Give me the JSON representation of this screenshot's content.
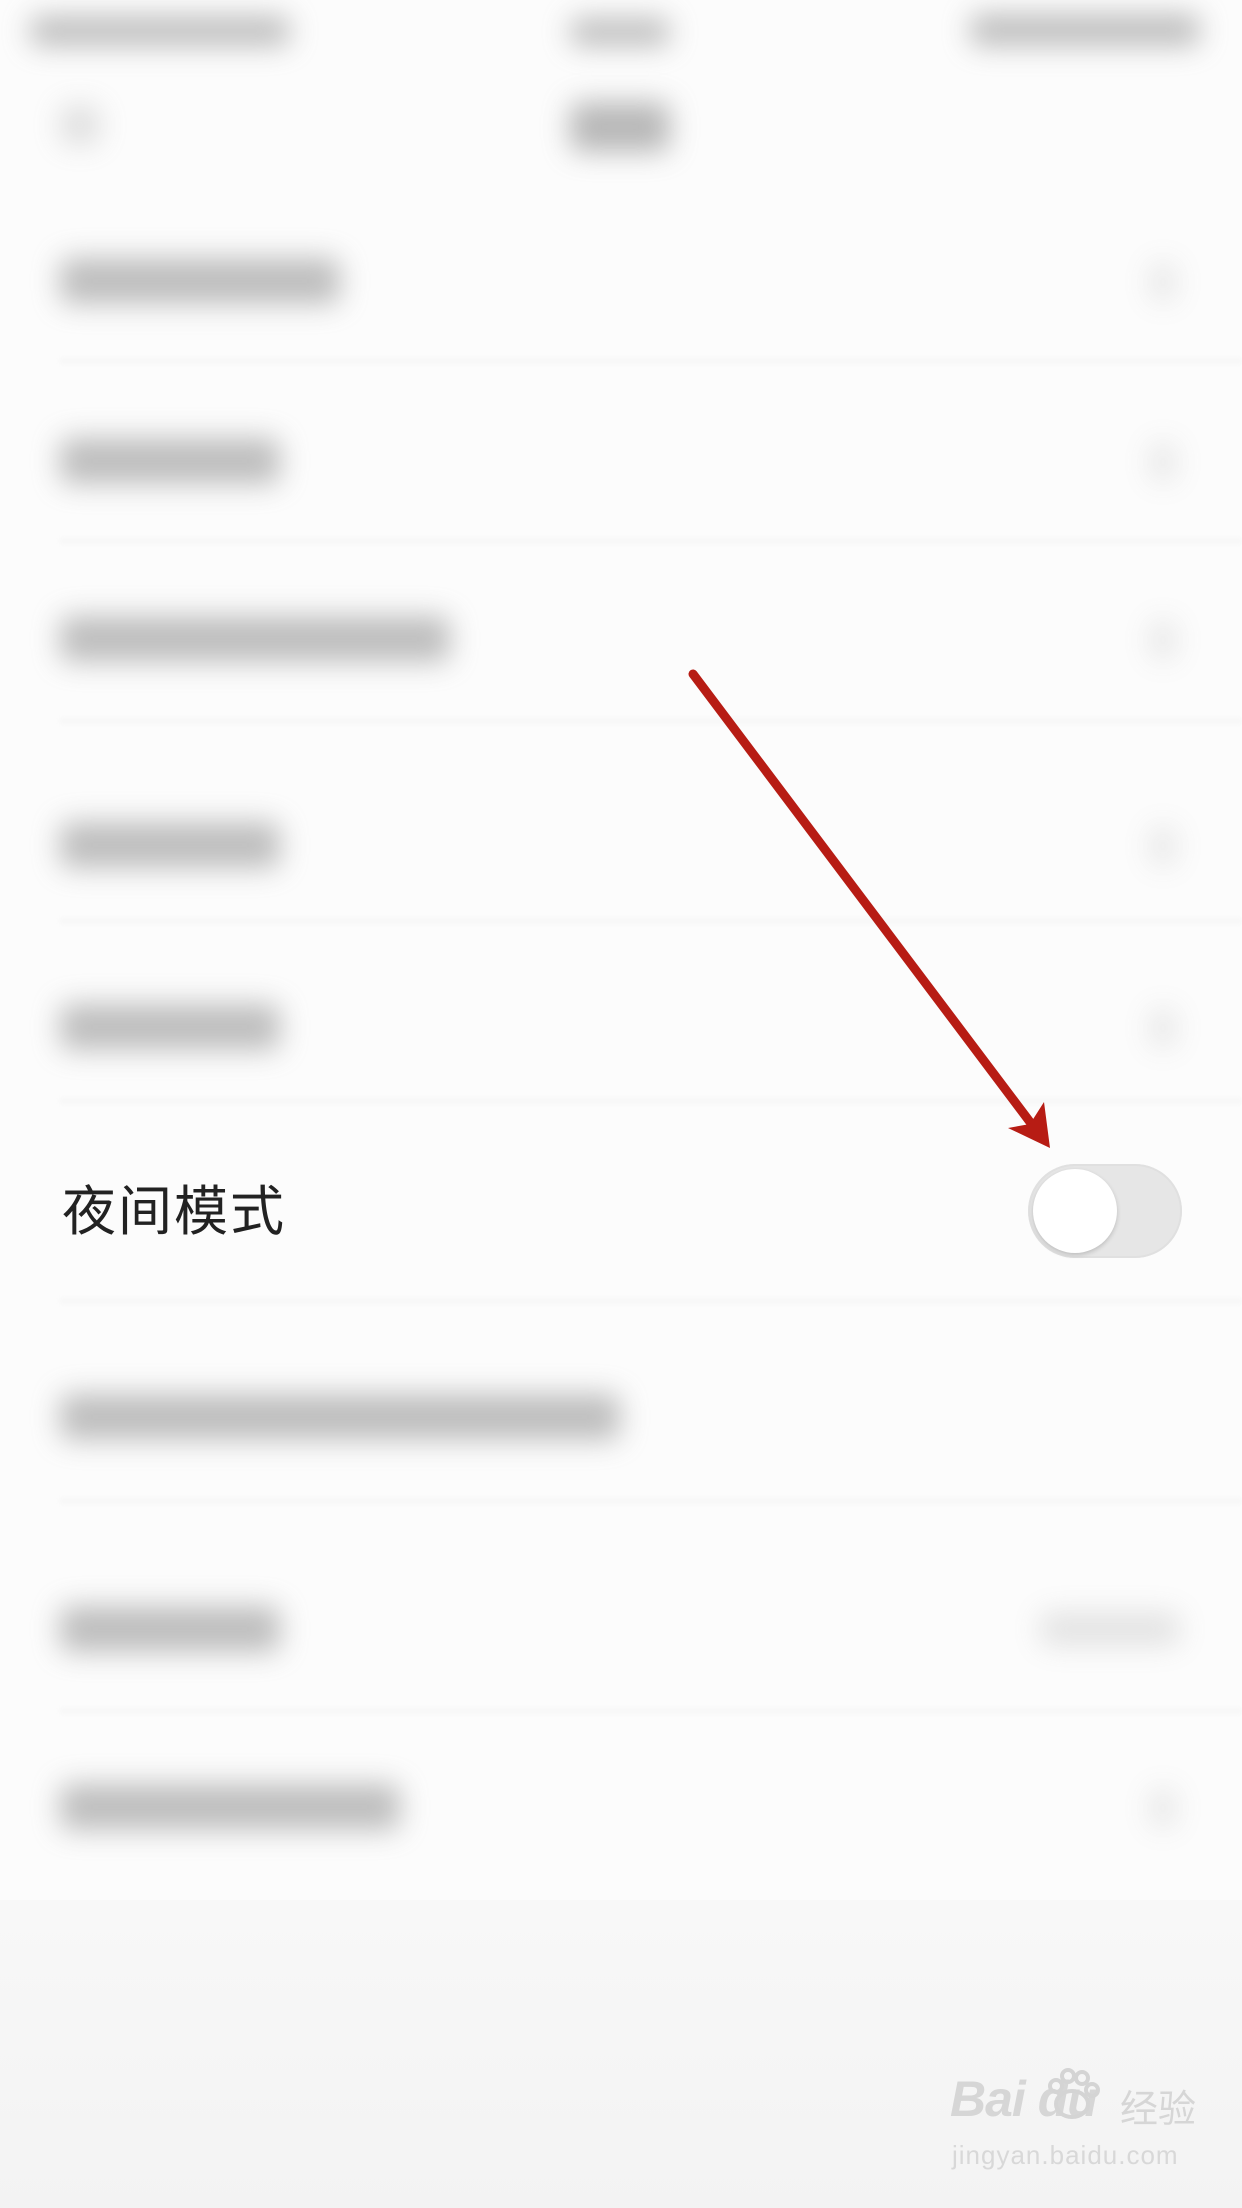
{
  "settings": {
    "night_mode_label": "夜间模式",
    "night_mode_on": false
  },
  "annotation": {
    "arrow_color": "#b71c14"
  },
  "watermark": {
    "logo_text": "Bai  du",
    "suffix_text": "经验",
    "url_text": "jingyan.baidu.com"
  },
  "colors": {
    "toggle_off_track": "#e6e6e6",
    "toggle_knob": "#ffffff"
  },
  "icons": {
    "back": "back-arrow-icon",
    "chevron": "chevron-right-icon",
    "watermark_paw": "baidu-paw-icon"
  }
}
